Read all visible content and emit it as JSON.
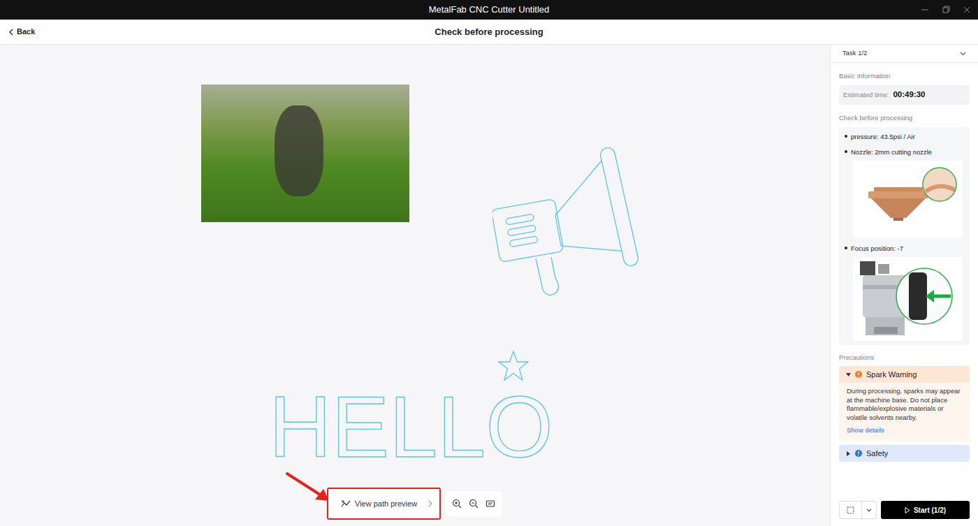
{
  "window": {
    "title": "MetalFab CNC Cutter Untitled"
  },
  "header": {
    "back": "Back",
    "title": "Check before processing"
  },
  "canvas": {
    "text": "HELLO"
  },
  "toolbar": {
    "preview": "View path preview"
  },
  "panel": {
    "task": "Task 1/2",
    "basic_label": "Basic Information",
    "time_label": "Estimated time:",
    "time": "00:49:30",
    "check_label": "Check before processing",
    "checks": [
      {
        "text": "pressure: 43.5psi / Air",
        "kind": "plain"
      },
      {
        "text": "Nozzle: 2mm cutting nozzle",
        "kind": "nozzle"
      },
      {
        "text": "Focus position: -7",
        "kind": "focus"
      }
    ],
    "precautions_label": "Precautions",
    "precautions": [
      {
        "title": "Spark Warning",
        "expanded": true,
        "color": "#f07b2c",
        "body": "During processing, sparks may appear at the machine base. Do not place flammable/explosive materials or volatile solvents nearby.",
        "link": "Show details"
      },
      {
        "title": "Safety",
        "expanded": false,
        "color": "#2f6fe0"
      }
    ],
    "start": "Start (1/2)"
  }
}
